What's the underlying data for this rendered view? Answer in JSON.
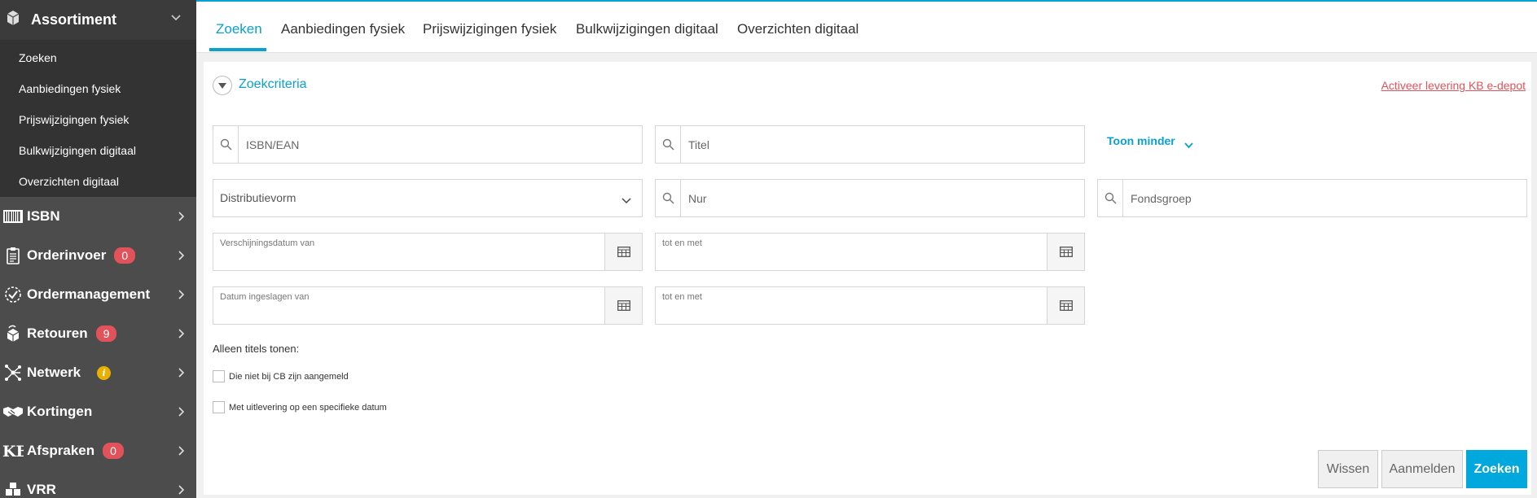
{
  "sidebar": {
    "header": {
      "label": "Assortiment",
      "icon": "book-box-icon"
    },
    "subitems": [
      {
        "label": "Zoeken"
      },
      {
        "label": "Aanbiedingen fysiek"
      },
      {
        "label": "Prijswijzigingen fysiek"
      },
      {
        "label": "Bulkwijzigingen digitaal"
      },
      {
        "label": "Overzichten digitaal"
      }
    ],
    "items": [
      {
        "label": "ISBN",
        "icon": "barcode-icon"
      },
      {
        "label": "Orderinvoer",
        "icon": "clipboard-icon",
        "badge": "0"
      },
      {
        "label": "Ordermanagement",
        "icon": "check-circle-icon"
      },
      {
        "label": "Retouren",
        "icon": "return-box-icon",
        "badge": "9"
      },
      {
        "label": "Netwerk",
        "icon": "network-icon",
        "info": "i"
      },
      {
        "label": "Kortingen",
        "icon": "handshake-icon"
      },
      {
        "label": "Afspraken",
        "icon": "kb-logo-icon",
        "badge": "0"
      },
      {
        "label": "VRR",
        "icon": "boxes-icon"
      }
    ]
  },
  "tabs": [
    "Zoeken",
    "Aanbiedingen fysiek",
    "Prijswijzigingen fysiek",
    "Bulkwijzigingen digitaal",
    "Overzichten digitaal"
  ],
  "active_tab": "Zoeken",
  "panel": {
    "title": "Zoekcriteria",
    "activeer_link": "Activeer levering KB e-depot",
    "toon_minder": "Toon minder",
    "fields": {
      "isbn_placeholder": "ISBN/EAN",
      "titel_placeholder": "Titel",
      "distributievorm_placeholder": "Distributievorm",
      "nur_placeholder": "Nur",
      "fondsgroep_placeholder": "Fondsgroep",
      "verschijning_van_label": "Verschijningsdatum van",
      "verschijning_tot_label": "tot en met",
      "ingeslagen_van_label": "Datum ingeslagen van",
      "ingeslagen_tot_label": "tot en met"
    },
    "alleen_label": "Alleen titels tonen:",
    "checkboxes": [
      {
        "label": "Die niet bij CB zijn aangemeld",
        "checked": false
      },
      {
        "label": "Met uitlevering op een specifieke datum",
        "checked": false
      }
    ],
    "buttons": {
      "wissen": "Wissen",
      "aanmelden": "Aanmelden",
      "zoeken": "Zoeken"
    }
  },
  "colors": {
    "accent": "#0aa0d0",
    "badge": "#e2525a",
    "link_red": "#e2525a",
    "sidebar_bg": "#4c4c4c"
  }
}
